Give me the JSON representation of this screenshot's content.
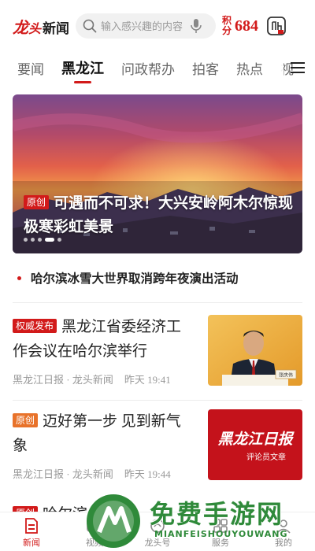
{
  "header": {
    "brand_part1": "龙",
    "brand_part2": "头",
    "brand_part3": "新闻",
    "search_placeholder": "输入感兴趣的内容",
    "points_label": "积分",
    "points_value": "684"
  },
  "tabs": [
    {
      "label": "要闻"
    },
    {
      "label": "黑龙江"
    },
    {
      "label": "问政帮办"
    },
    {
      "label": "拍客"
    },
    {
      "label": "热点"
    },
    {
      "label": "视"
    }
  ],
  "active_tab": "黑龙江",
  "banner": {
    "badge": "原创",
    "title": "可遇而不可求！大兴安岭阿木尔惊现极寒彩虹美景",
    "slide_count": 5,
    "active_slide": 3
  },
  "headline": {
    "text": "哈尔滨冰雪大世界取消跨年夜演出活动"
  },
  "news": [
    {
      "tag": "权威发布",
      "title": "黑龙江省委经济工作会议在哈尔滨举行",
      "source": "黑龙江日报 · 龙头新闻",
      "time": "昨天 19:41",
      "thumb_caption": "张庆伟"
    },
    {
      "tag": "原创",
      "title": "迈好第一步 见到新气象",
      "source": "黑龙江日报 · 龙头新闻",
      "time": "昨天 19:44",
      "thumb_title": "黑龙江日报",
      "thumb_subtitle": "评论员文章"
    }
  ],
  "partial_item": {
    "tag": "原创",
    "title_fragment": "哈尔滨"
  },
  "bottom_nav": [
    {
      "label": "新闻",
      "icon": "news-icon",
      "active": true
    },
    {
      "label": "视频",
      "icon": "video-icon",
      "active": false
    },
    {
      "label": "龙头号",
      "icon": "dragon-icon",
      "active": false
    },
    {
      "label": "服务",
      "icon": "service-icon",
      "active": false
    },
    {
      "label": "我的",
      "icon": "user-icon",
      "active": false
    }
  ],
  "watermark": {
    "text": "免费手游网",
    "sub": "MIANFEISHOUYOUWANG"
  },
  "colors": {
    "brand_red": "#d21a1a",
    "tag_orange": "#e8722a",
    "watermark_green": "#2f8a3a"
  }
}
